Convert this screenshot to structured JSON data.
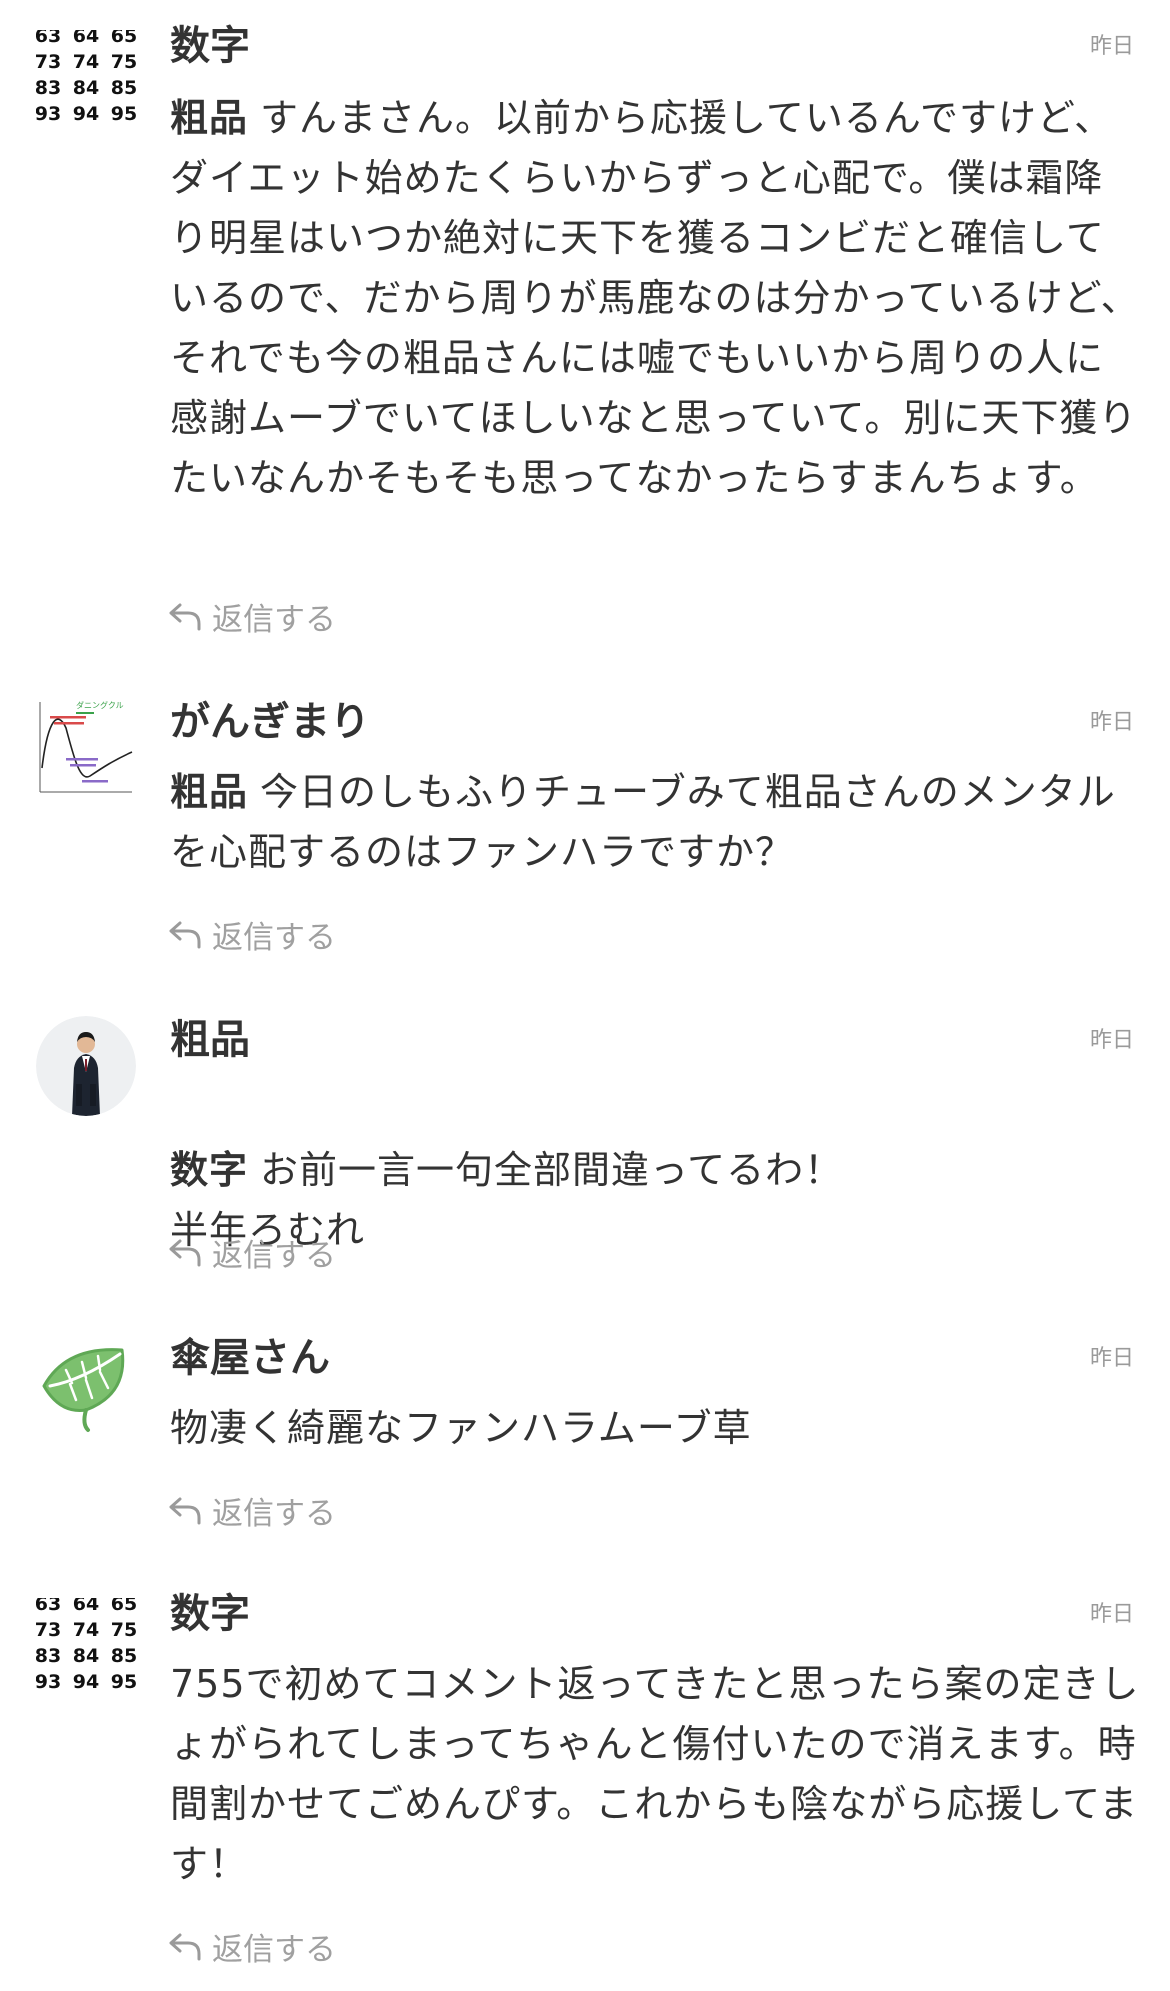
{
  "comments": [
    {
      "author": "数字",
      "time": "昨日",
      "mention": "粗品",
      "text": "すんまさん。以前から応援しているんですけど、ダイエット始めたくらいからずっと心配で。僕は霜降り明星はいつか絶対に天下を獲るコンビだと確信しているので、だから周りが馬鹿なのは分かっているけど、それでも今の粗品さんには嘘でもいいから周りの人に感謝ムーブでいてほしいなと思っていて。別に天下獲りたいなんかそもそも思ってなかったらすまんちょす。",
      "reply_label": "返信する",
      "avatar": {
        "type": "number-grid",
        "numbers": [
          "63",
          "64",
          "65",
          "73",
          "74",
          "75",
          "83",
          "84",
          "85",
          "93",
          "94",
          "95"
        ]
      }
    },
    {
      "author": "がんぎまり",
      "time": "昨日",
      "mention": "粗品",
      "text": "今日のしもふりチューブみて粗品さんのメンタルを心配するのはファンハラですか？",
      "reply_label": "返信する",
      "avatar": {
        "type": "dunning-kruger-graph",
        "caption": "ダニングクル"
      }
    },
    {
      "author": "粗品",
      "time": "昨日",
      "mention": "数字",
      "text": "お前一言一句全部間違ってるわ！\n半年ろむれ",
      "reply_label": "返信する",
      "avatar": {
        "type": "person-photo"
      }
    },
    {
      "author": "傘屋さん",
      "time": "昨日",
      "mention": "",
      "text": "物凄く綺麗なファンハラムーブ草",
      "reply_label": "返信する",
      "avatar": {
        "type": "leaf-icon"
      }
    },
    {
      "author": "数字",
      "time": "昨日",
      "mention": "",
      "text": "755で初めてコメント返ってきたと思ったら案の定きしょがられてしまってちゃんと傷付いたので消えます。時間割かせてごめんぴす。これからも陰ながら応援してます！",
      "reply_label": "返信する",
      "avatar": {
        "type": "number-grid",
        "numbers": [
          "63",
          "64",
          "65",
          "73",
          "74",
          "75",
          "83",
          "84",
          "85",
          "93",
          "94",
          "95"
        ]
      }
    }
  ],
  "colors": {
    "text": "#333333",
    "muted": "#9a9a9a",
    "leaf": "#6cb365"
  }
}
